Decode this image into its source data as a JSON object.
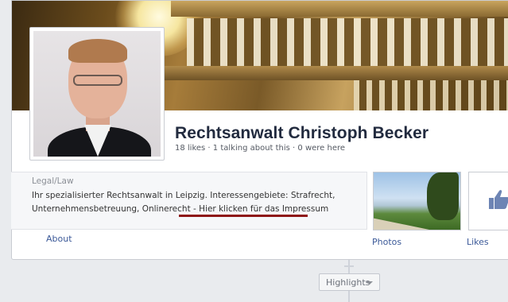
{
  "page": {
    "title": "Rechtsanwalt Christoph Becker",
    "stats": "18 likes · 1 talking about this · 0 were here"
  },
  "about": {
    "category": "Legal/Law",
    "description_line1": "Ihr spezialisierter Rechtsanwalt in Leipzig. Interessengebiete: Strafrecht,",
    "description_line2_start": "Unternehmensbetreuung, Onlinerecht",
    "description_line2_link": " - Hier klicken für das Impressum",
    "link_label": "About",
    "underline_color": "#8e1414"
  },
  "apps": [
    {
      "label": "Photos",
      "icon": "photo-thumbnail"
    },
    {
      "label": "Likes",
      "icon": "thumbs-up-icon"
    }
  ],
  "timeline": {
    "highlights_label": "Highlights"
  },
  "colors": {
    "link": "#3b5998",
    "title": "#222b3f"
  }
}
